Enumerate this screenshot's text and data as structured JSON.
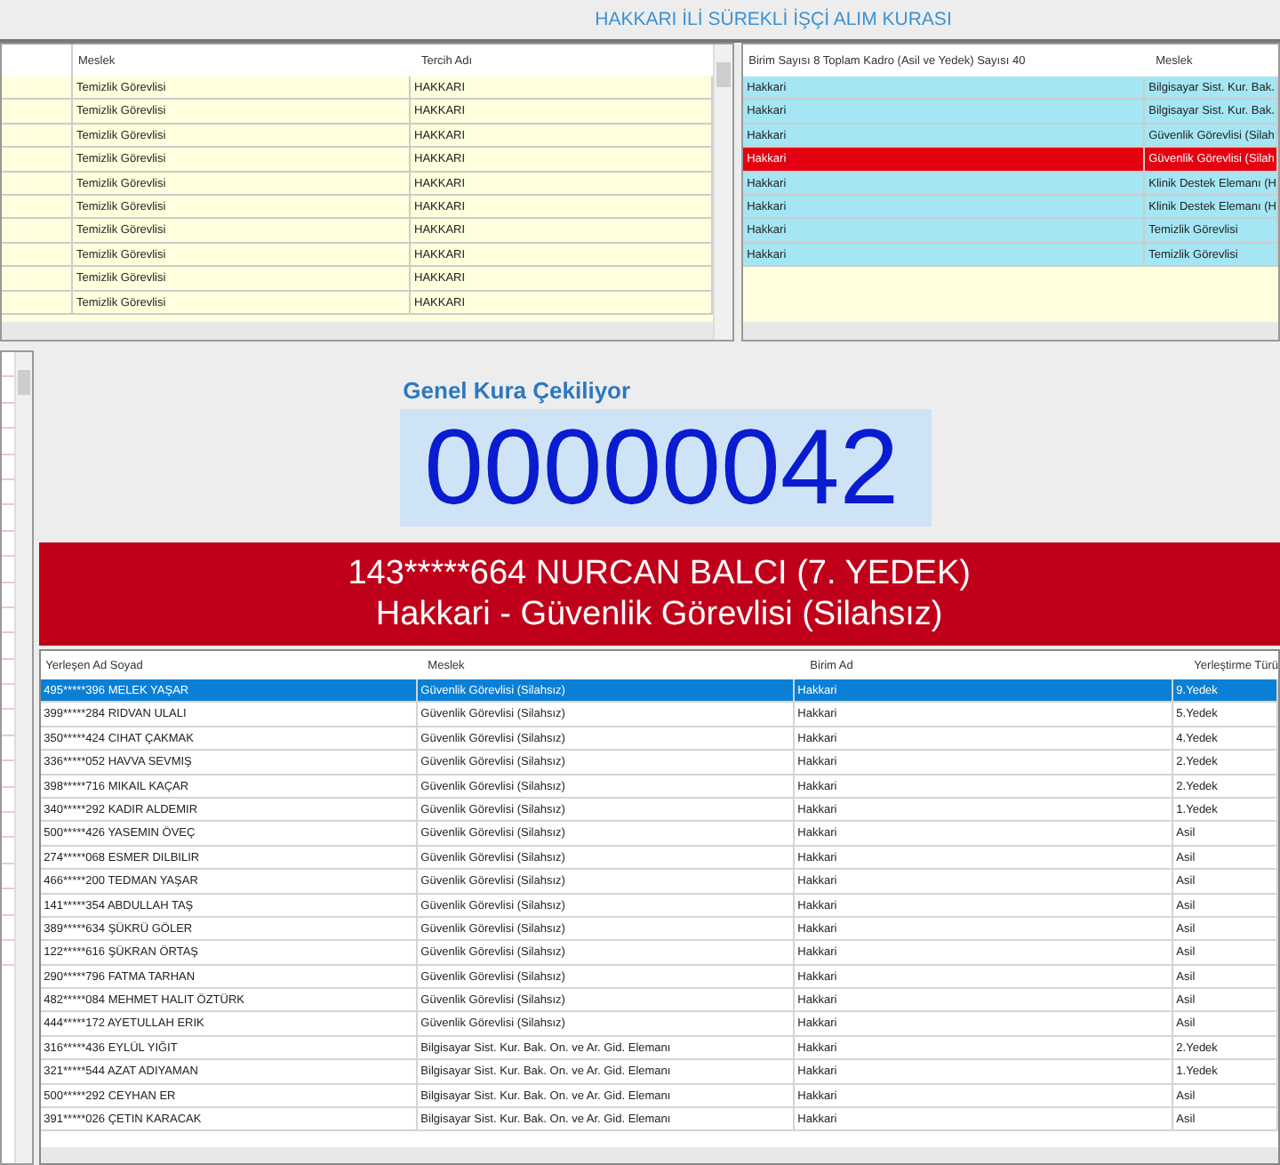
{
  "title": "HAKKARI İLİ SÜREKLİ İŞÇİ ALIM KURASI",
  "preference_table": {
    "columns": [
      "Meslek",
      "Tercih Adı"
    ],
    "rows": [
      {
        "meslek": "Temizlik Görevlisi",
        "tercih": "HAKKARI"
      },
      {
        "meslek": "Temizlik Görevlisi",
        "tercih": "HAKKARI"
      },
      {
        "meslek": "Temizlik Görevlisi",
        "tercih": "HAKKARI"
      },
      {
        "meslek": "Temizlik Görevlisi",
        "tercih": "HAKKARI"
      },
      {
        "meslek": "Temizlik Görevlisi",
        "tercih": "HAKKARI"
      },
      {
        "meslek": "Temizlik Görevlisi",
        "tercih": "HAKKARI"
      },
      {
        "meslek": "Temizlik Görevlisi",
        "tercih": "HAKKARI"
      },
      {
        "meslek": "Temizlik Görevlisi",
        "tercih": "HAKKARI"
      },
      {
        "meslek": "Temizlik Görevlisi",
        "tercih": "HAKKARI"
      },
      {
        "meslek": "Temizlik Görevlisi",
        "tercih": "HAKKARI"
      }
    ]
  },
  "unit_table": {
    "columns": [
      "Birim Sayısı 8 Toplam Kadro (Asil ve Yedek) Sayısı 40",
      "Meslek"
    ],
    "rows": [
      {
        "birim": "Hakkari",
        "meslek": "Bilgisayar Sist. Kur. Bak.",
        "selected": false
      },
      {
        "birim": "Hakkari",
        "meslek": "Bilgisayar Sist. Kur. Bak.",
        "selected": false
      },
      {
        "birim": "Hakkari",
        "meslek": "Güvenlik Görevlisi (Silah",
        "selected": false
      },
      {
        "birim": "Hakkari",
        "meslek": "Güvenlik Görevlisi (Silah",
        "selected": true
      },
      {
        "birim": "Hakkari",
        "meslek": "Klinik Destek Elemanı (H",
        "selected": false
      },
      {
        "birim": "Hakkari",
        "meslek": "Klinik Destek Elemanı (H",
        "selected": false
      },
      {
        "birim": "Hakkari",
        "meslek": "Temizlik Görevlisi",
        "selected": false
      },
      {
        "birim": "Hakkari",
        "meslek": "Temizlik Görevlisi",
        "selected": false
      }
    ]
  },
  "draw": {
    "label": "Genel Kura Çekiliyor",
    "number": "00000042"
  },
  "winner": {
    "line_1": "143*****664 NURCAN BALCI (7. YEDEK)",
    "line_2": "Hakkari - Güvenlik Görevlisi (Silahsız)"
  },
  "placed_table": {
    "columns": [
      "Yerleşen Ad Soyad",
      "Meslek",
      "Birim Ad",
      "Yerleştirme Türü"
    ],
    "rows": [
      {
        "name": "495*****396 MELEK YAŞAR",
        "meslek": "Güvenlik Görevlisi (Silahsız)",
        "birim": "Hakkari",
        "tur": "9.Yedek",
        "selected": true
      },
      {
        "name": "399*****284 RIDVAN ULALI",
        "meslek": "Güvenlik Görevlisi (Silahsız)",
        "birim": "Hakkari",
        "tur": "5.Yedek",
        "selected": false
      },
      {
        "name": "350*****424 CIHAT ÇAKMAK",
        "meslek": "Güvenlik Görevlisi (Silahsız)",
        "birim": "Hakkari",
        "tur": "4.Yedek",
        "selected": false
      },
      {
        "name": "336*****052 HAVVA SEVMIŞ",
        "meslek": "Güvenlik Görevlisi (Silahsız)",
        "birim": "Hakkari",
        "tur": "2.Yedek",
        "selected": false
      },
      {
        "name": "398*****716 MIKAIL KAÇAR",
        "meslek": "Güvenlik Görevlisi (Silahsız)",
        "birim": "Hakkari",
        "tur": "2.Yedek",
        "selected": false
      },
      {
        "name": "340*****292 KADIR ALDEMIR",
        "meslek": "Güvenlik Görevlisi (Silahsız)",
        "birim": "Hakkari",
        "tur": "1.Yedek",
        "selected": false
      },
      {
        "name": "500*****426 YASEMIN ÖVEÇ",
        "meslek": "Güvenlik Görevlisi (Silahsız)",
        "birim": "Hakkari",
        "tur": "Asil",
        "selected": false
      },
      {
        "name": "274*****068 ESMER DILBILIR",
        "meslek": "Güvenlik Görevlisi (Silahsız)",
        "birim": "Hakkari",
        "tur": "Asil",
        "selected": false
      },
      {
        "name": "466*****200 TEDMAN YAŞAR",
        "meslek": "Güvenlik Görevlisi (Silahsız)",
        "birim": "Hakkari",
        "tur": "Asil",
        "selected": false
      },
      {
        "name": "141*****354 ABDULLAH TAŞ",
        "meslek": "Güvenlik Görevlisi (Silahsız)",
        "birim": "Hakkari",
        "tur": "Asil",
        "selected": false
      },
      {
        "name": "389*****634 ŞÜKRÜ GÖLER",
        "meslek": "Güvenlik Görevlisi (Silahsız)",
        "birim": "Hakkari",
        "tur": "Asil",
        "selected": false
      },
      {
        "name": "122*****616 ŞÜKRAN ÖRTAŞ",
        "meslek": "Güvenlik Görevlisi (Silahsız)",
        "birim": "Hakkari",
        "tur": "Asil",
        "selected": false
      },
      {
        "name": "290*****796 FATMA TARHAN",
        "meslek": "Güvenlik Görevlisi (Silahsız)",
        "birim": "Hakkari",
        "tur": "Asil",
        "selected": false
      },
      {
        "name": "482*****084 MEHMET HALIT ÖZTÜRK",
        "meslek": "Güvenlik Görevlisi (Silahsız)",
        "birim": "Hakkari",
        "tur": "Asil",
        "selected": false
      },
      {
        "name": "444*****172 AYETULLAH ERIK",
        "meslek": "Güvenlik Görevlisi (Silahsız)",
        "birim": "Hakkari",
        "tur": "Asil",
        "selected": false
      },
      {
        "name": "316*****436 EYLÜL YIĞIT",
        "meslek": "Bilgisayar Sist. Kur. Bak. On. ve Ar. Gid. Elemanı",
        "birim": "Hakkari",
        "tur": "2.Yedek",
        "selected": false
      },
      {
        "name": "321*****544 AZAT ADIYAMAN",
        "meslek": "Bilgisayar Sist. Kur. Bak. On. ve Ar. Gid. Elemanı",
        "birim": "Hakkari",
        "tur": "1.Yedek",
        "selected": false
      },
      {
        "name": "500*****292 CEYHAN ER",
        "meslek": "Bilgisayar Sist. Kur. Bak. On. ve Ar. Gid. Elemanı",
        "birim": "Hakkari",
        "tur": "Asil",
        "selected": false
      },
      {
        "name": "391*****026 ÇETIN KARACAK",
        "meslek": "Bilgisayar Sist. Kur. Bak. On. ve Ar. Gid. Elemanı",
        "birim": "Hakkari",
        "tur": "Asil",
        "selected": false
      }
    ]
  }
}
